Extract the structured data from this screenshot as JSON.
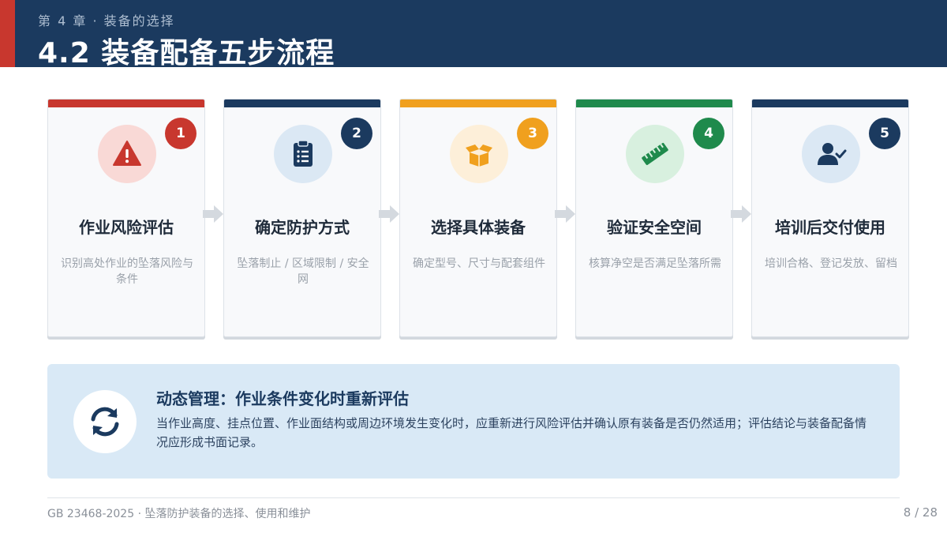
{
  "header": {
    "chapter": "第 4 章 · 装备的选择",
    "title": "4.2 装备配备五步流程"
  },
  "steps": [
    {
      "number": "1",
      "title": "作业风险评估",
      "desc": "识别高处作业的坠落风险与条件",
      "icon": "warning-icon",
      "accent": "#c8372e",
      "tint": "#f9d9d6"
    },
    {
      "number": "2",
      "title": "确定防护方式",
      "desc": "坠落制止 / 区域限制 / 安全网",
      "icon": "clipboard-list-icon",
      "accent": "#1b3a5f",
      "tint": "#dbe8f4"
    },
    {
      "number": "3",
      "title": "选择具体装备",
      "desc": "确定型号、尺寸与配套组件",
      "icon": "box-open-icon",
      "accent": "#f0a01e",
      "tint": "#fdefd9"
    },
    {
      "number": "4",
      "title": "验证安全空间",
      "desc": "核算净空是否满足坠落所需",
      "icon": "ruler-icon",
      "accent": "#1f8a4c",
      "tint": "#d8f0df"
    },
    {
      "number": "5",
      "title": "培训后交付使用",
      "desc": "培训合格、登记发放、留档",
      "icon": "user-check-icon",
      "accent": "#1b3a5f",
      "tint": "#dbe8f4"
    }
  ],
  "panel": {
    "icon": "sync-icon",
    "title": "动态管理：作业条件变化时重新评估",
    "text": "当作业高度、挂点位置、作业面结构或周边环境发生变化时，应重新进行风险评估并确认原有装备是否仍然适用；评估结论与装备配备情况应形成书面记录。"
  },
  "footer": {
    "left": "GB 23468-2025 · 坠落防护装备的选择、使用和维护",
    "page": "8 / 28"
  },
  "colors": {
    "navy": "#1b3a5f",
    "red": "#c8372e",
    "panel_bg": "#d9e9f6"
  }
}
